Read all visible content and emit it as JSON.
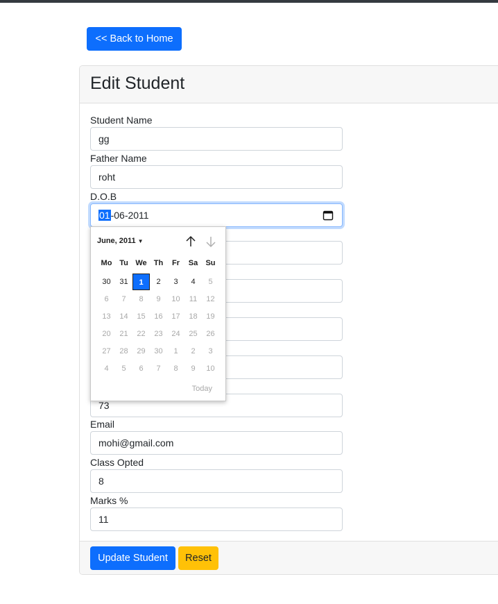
{
  "nav": {
    "back_label": "<< Back to Home"
  },
  "card": {
    "title": "Edit Student"
  },
  "fields": {
    "student_name": {
      "label": "Student Name",
      "value": "gg"
    },
    "father_name": {
      "label": "Father Name",
      "value": "roht"
    },
    "dob": {
      "label": "D.O.B",
      "value_selected": "01",
      "value_rest": "-06-2011"
    },
    "roll_no": {
      "value": "73"
    },
    "email": {
      "label": "Email",
      "value": "mohi@gmail.com"
    },
    "class_opted": {
      "label": "Class Opted",
      "value": "8"
    },
    "marks": {
      "label": "Marks %",
      "value": "11"
    }
  },
  "actions": {
    "update_label": "Update Student",
    "reset_label": "Reset"
  },
  "datepicker": {
    "month_label": "June, 2011",
    "weekdays": [
      "Mo",
      "Tu",
      "We",
      "Th",
      "Fr",
      "Sa",
      "Su"
    ],
    "weeks": [
      [
        "30",
        "31",
        "1",
        "2",
        "3",
        "4",
        "5"
      ],
      [
        "6",
        "7",
        "8",
        "9",
        "10",
        "11",
        "12"
      ],
      [
        "13",
        "14",
        "15",
        "16",
        "17",
        "18",
        "19"
      ],
      [
        "20",
        "21",
        "22",
        "23",
        "24",
        "25",
        "26"
      ],
      [
        "27",
        "28",
        "29",
        "30",
        "1",
        "2",
        "3"
      ],
      [
        "4",
        "5",
        "6",
        "7",
        "8",
        "9",
        "10"
      ]
    ],
    "active": [
      [
        false,
        false,
        true,
        true,
        true,
        true,
        false
      ]
    ],
    "selected_day": "1",
    "today_label": "Today"
  },
  "colors": {
    "primary": "#0d6efd",
    "warning": "#ffc107",
    "header_bg": "#f7f7f7"
  }
}
